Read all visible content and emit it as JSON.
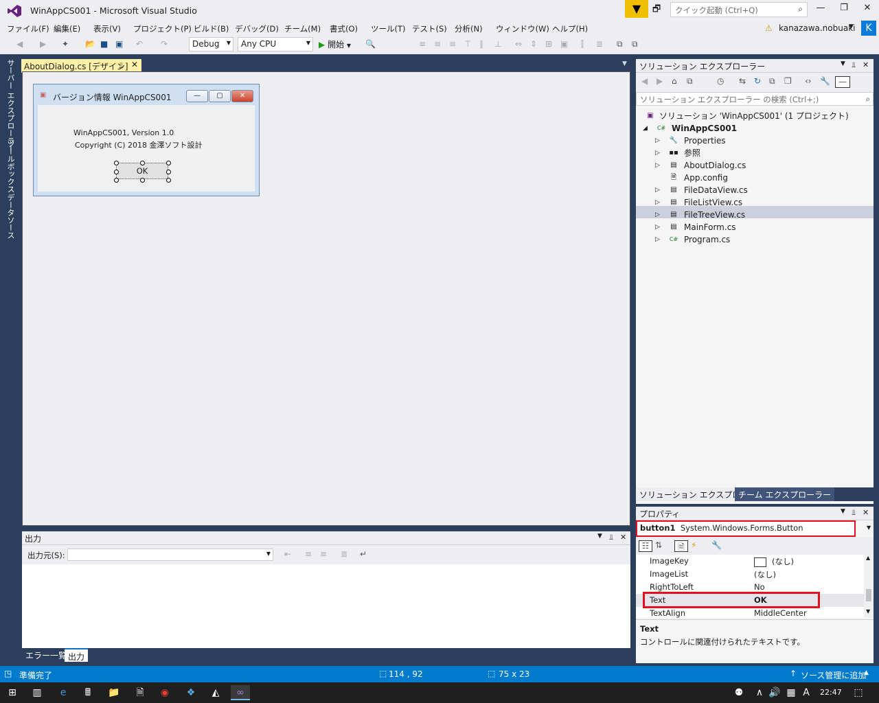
{
  "window": {
    "title": "WinAppCS001 - Microsoft Visual Studio",
    "quick_launch_placeholder": "クイック起動 (Ctrl+Q)"
  },
  "menu": [
    "ファイル(F)",
    "編集(E)",
    "表示(V)",
    "プロジェクト(P)",
    "ビルド(B)",
    "デバッグ(D)",
    "チーム(M)",
    "書式(O)",
    "ツール(T)",
    "テスト(S)",
    "分析(N)",
    "ウィンドウ(W)",
    "ヘルプ(H)"
  ],
  "user": {
    "name": "kanazawa.nobuaki",
    "avatar_letter": "K"
  },
  "toolbar": {
    "config": "Debug",
    "platform": "Any CPU",
    "start_label": "開始"
  },
  "left_tabs": [
    "サーバー エクスプローラー",
    "ツールボックス",
    "データソース"
  ],
  "document": {
    "tab_label": "AboutDialog.cs [デザイン]"
  },
  "dialog": {
    "title": "バージョン情報 WinAppCS001",
    "line1": "WinAppCS001, Version 1.0",
    "line2": "Copyright (C) 2018 金澤ソフト設計",
    "ok_label": "OK"
  },
  "output": {
    "title": "出力",
    "source_label": "出力元(S):"
  },
  "bottom_tabs": [
    "エラー一覧",
    "出力"
  ],
  "solution_explorer": {
    "title": "ソリューション エクスプローラー",
    "search_placeholder": "ソリューション エクスプローラー の検索 (Ctrl+;)",
    "solution": "ソリューション 'WinAppCS001' (1 プロジェクト)",
    "project": "WinAppCS001",
    "items": [
      "Properties",
      "参照",
      "AboutDialog.cs",
      "App.config",
      "FileDataView.cs",
      "FileListView.cs",
      "FileTreeView.cs",
      "MainForm.cs",
      "Program.cs"
    ],
    "tabs": [
      "ソリューション エクスプローラー",
      "チーム エクスプローラー"
    ]
  },
  "properties": {
    "title": "プロパティ",
    "object_name": "button1",
    "object_type": "System.Windows.Forms.Button",
    "rows": [
      {
        "name": "ImageKey",
        "value": "(なし)"
      },
      {
        "name": "ImageList",
        "value": "(なし)"
      },
      {
        "name": "RightToLeft",
        "value": "No"
      },
      {
        "name": "Text",
        "value": "OK"
      },
      {
        "name": "TextAlign",
        "value": "MiddleCenter"
      }
    ],
    "desc_title": "Text",
    "desc_text": "コントロールに関連付けられたテキストです。"
  },
  "status": {
    "ready": "準備完了",
    "position": "114 , 92",
    "size": "75 x 23",
    "source_control": "ソース管理に追加"
  },
  "taskbar": {
    "time": "22:47"
  },
  "colors": {
    "accent": "#007acc",
    "highlight": "#e01020",
    "tab_active": "#fff1a8"
  }
}
